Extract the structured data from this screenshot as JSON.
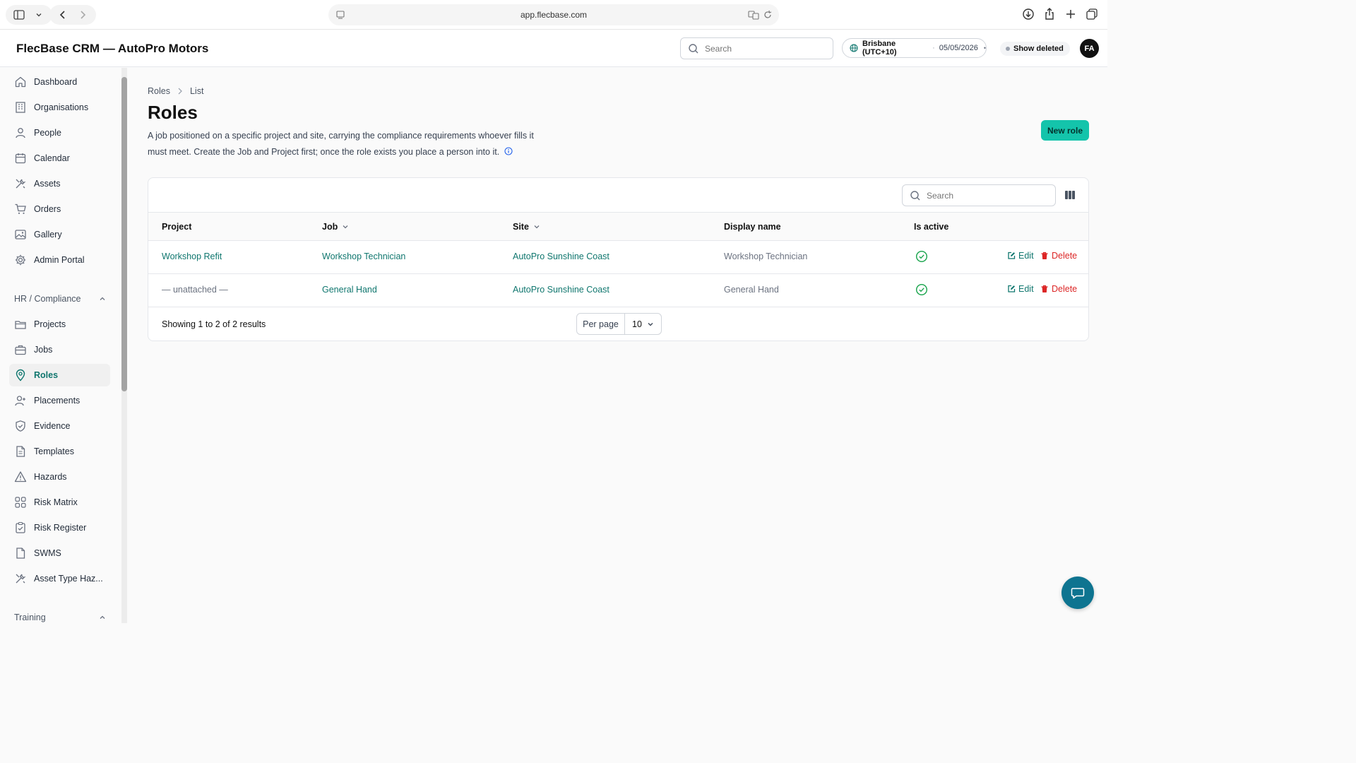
{
  "browser": {
    "url": "app.flecbase.com"
  },
  "header": {
    "brand": "FlecBase CRM — AutoPro Motors",
    "search_placeholder": "Search",
    "timezone": "Brisbane (UTC+10)",
    "date": "05/05/2026",
    "show_deleted": "Show deleted",
    "avatar_initials": "FA"
  },
  "sidebar": {
    "items": [
      {
        "label": "Dashboard",
        "icon": "home-icon"
      },
      {
        "label": "Organisations",
        "icon": "building-icon"
      },
      {
        "label": "People",
        "icon": "user-icon"
      },
      {
        "label": "Calendar",
        "icon": "calendar-icon"
      },
      {
        "label": "Assets",
        "icon": "tools-icon"
      },
      {
        "label": "Orders",
        "icon": "cart-icon"
      },
      {
        "label": "Gallery",
        "icon": "image-icon"
      },
      {
        "label": "Admin Portal",
        "icon": "gear-icon"
      }
    ],
    "section_hr": "HR / Compliance",
    "hr_items": [
      {
        "label": "Projects",
        "icon": "folder-icon"
      },
      {
        "label": "Jobs",
        "icon": "briefcase-icon"
      },
      {
        "label": "Roles",
        "icon": "map-pin-icon",
        "active": true
      },
      {
        "label": "Placements",
        "icon": "user-plus-icon"
      },
      {
        "label": "Evidence",
        "icon": "shield-check-icon"
      },
      {
        "label": "Templates",
        "icon": "document-icon"
      },
      {
        "label": "Hazards",
        "icon": "warning-icon"
      },
      {
        "label": "Risk Matrix",
        "icon": "grid-icon"
      },
      {
        "label": "Risk Register",
        "icon": "clipboard-check-icon"
      },
      {
        "label": "SWMS",
        "icon": "document-icon"
      },
      {
        "label": "Asset Type Haz...",
        "icon": "tools-icon"
      }
    ],
    "section_training": "Training"
  },
  "main": {
    "breadcrumb": [
      "Roles",
      "List"
    ],
    "title": "Roles",
    "description": "A job positioned on a specific project and site, carrying the compliance requirements whoever fills it must meet. Create the Job and Project first; once the role exists you place a person into it.",
    "new_button": "New role",
    "table": {
      "search_placeholder": "Search",
      "columns": [
        "Project",
        "Job",
        "Site",
        "Display name",
        "Is active"
      ],
      "rows": [
        {
          "project": "Workshop Refit",
          "job": "Workshop Technician",
          "site": "AutoPro Sunshine Coast",
          "display_name": "Workshop Technician",
          "active": true
        },
        {
          "project": "— unattached —",
          "job": "General Hand",
          "site": "AutoPro Sunshine Coast",
          "display_name": "General Hand",
          "active": true
        }
      ],
      "edit_label": "Edit",
      "delete_label": "Delete",
      "summary": "Showing 1 to 2 of 2 results",
      "per_page_label": "Per page",
      "per_page_value": "10"
    }
  },
  "colors": {
    "accent": "#0f766e",
    "primary_button": "#14c4ab",
    "danger": "#dc2626",
    "chat": "#0e7490"
  }
}
